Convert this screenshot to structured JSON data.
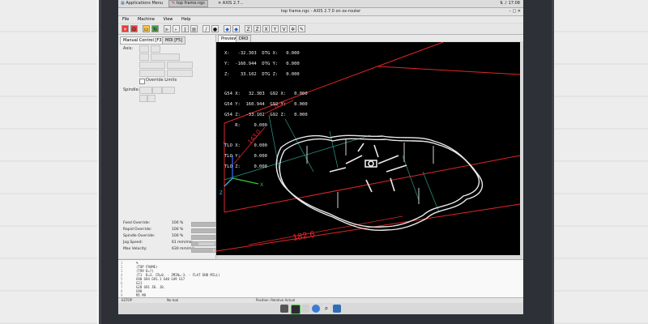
{
  "panel": {
    "apps_menu": "Applications Menu",
    "task1": "top frame.ngc",
    "task2": "AXIS 2.7...",
    "clock": "17:08"
  },
  "window": {
    "title": "top frame.ngc - AXIS 2.7.0 on ox-router",
    "menus": [
      "File",
      "Machine",
      "View",
      "Help"
    ]
  },
  "left": {
    "tab_manual": "Manual Control [F3]",
    "tab_mdi": "MDI [F5]",
    "axis_label": "Axis:",
    "override_limits": "Override Limits",
    "spindle_label": "Spindle:"
  },
  "sliders": [
    {
      "name": "Feed Override:",
      "value": "100 %"
    },
    {
      "name": "Rapid Override:",
      "value": "100 %"
    },
    {
      "name": "Spindle Override:",
      "value": "100 %"
    },
    {
      "name": "Jog Speed:",
      "value": "61 mm/min"
    },
    {
      "name": "Max Velocity:",
      "value": "630 mm/min"
    }
  ],
  "view": {
    "tab_preview": "Preview",
    "tab_dro": "DRO",
    "dro": {
      "rel": [
        {
          "axis": "X:",
          "value": "-32.303",
          "dtg": "DTG X:",
          "dtg_value": "0.000"
        },
        {
          "axis": "Y:",
          "value": "-160.944",
          "dtg": "DTG Y:",
          "dtg_value": "0.000"
        },
        {
          "axis": "Z:",
          "value": "33.102",
          "dtg": "DTG Z:",
          "dtg_value": "0.000"
        }
      ],
      "g54": [
        {
          "axis": "G54 X:",
          "value": "32.303",
          "g92": "G92 X:",
          "g92_value": "0.000"
        },
        {
          "axis": "G54 Y:",
          "value": "160.944",
          "g92": "G92 Y:",
          "g92_value": "0.000"
        },
        {
          "axis": "G54 Z:",
          "value": "-33.102",
          "g92": "G92 Z:",
          "g92_value": "0.000"
        },
        {
          "axis": "R:",
          "value": "0.000",
          "g92": "",
          "g92_value": ""
        }
      ],
      "tlo": [
        {
          "axis": "TLO X:",
          "value": "0.000"
        },
        {
          "axis": "TLO Y:",
          "value": "0.000"
        },
        {
          "axis": "TLO Z:",
          "value": "0.000"
        }
      ]
    },
    "dims": {
      "width": "182.6",
      "height": "143.0",
      "depth": "141.5"
    },
    "colors": {
      "extents": "#e0262a",
      "axis_x": "#2bd12b",
      "axis_y": "#3c6cff",
      "axis_z": "#49c8ff",
      "path": "#eaeaea",
      "rapid": "#2e9a8a"
    }
  },
  "gcode": {
    "lines": [
      {
        "num": "1",
        "text": "%"
      },
      {
        "num": "2",
        "text": "(TOP FRAME)"
      },
      {
        "num": "3",
        "text": "(T99 D=?)"
      },
      {
        "num": "4",
        "text": "(T1  D=3. CR=0. - ZMIN=-3. - FLAT END MILL)"
      },
      {
        "num": "5",
        "text": "G90 G94 G91.1 G40 G49 G17"
      },
      {
        "num": "6",
        "text": "G21"
      },
      {
        "num": "7",
        "text": "G28 G91 Z0. J0."
      },
      {
        "num": "8",
        "text": "G90"
      },
      {
        "num": "9",
        "text": "M5 M9"
      }
    ]
  },
  "status": {
    "state": "ESTOP",
    "tool": "No tool",
    "position": "Position: Relative Actual"
  }
}
